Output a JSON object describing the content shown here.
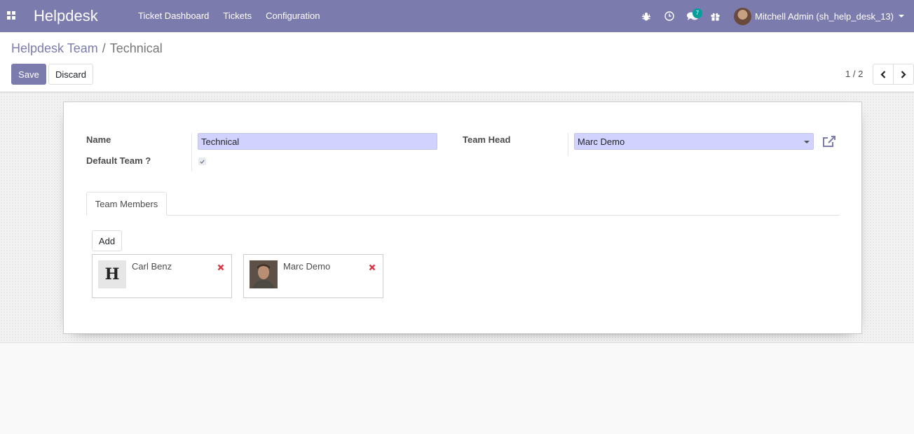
{
  "navbar": {
    "brand": "Helpdesk",
    "menu": [
      "Ticket Dashboard",
      "Tickets",
      "Configuration"
    ],
    "messages_count": "7",
    "user_name": "Mitchell Admin (sh_help_desk_13)",
    "bg_color": "#7c7bad"
  },
  "breadcrumb": {
    "parent": "Helpdesk Team",
    "separator": "/",
    "current": "Technical"
  },
  "actions": {
    "save_label": "Save",
    "discard_label": "Discard"
  },
  "pager": {
    "value": "1 / 2"
  },
  "form": {
    "name_label": "Name",
    "name_value": "Technical",
    "default_team_label": "Default Team ?",
    "default_team_checked": true,
    "team_head_label": "Team Head",
    "team_head_value": "Marc Demo"
  },
  "tabs": [
    {
      "label": "Team Members",
      "active": true
    }
  ],
  "members": {
    "add_label": "Add",
    "items": [
      {
        "name": "Carl Benz",
        "image": "placeholder-icon"
      },
      {
        "name": "Marc Demo",
        "image": "user-photo"
      }
    ]
  }
}
